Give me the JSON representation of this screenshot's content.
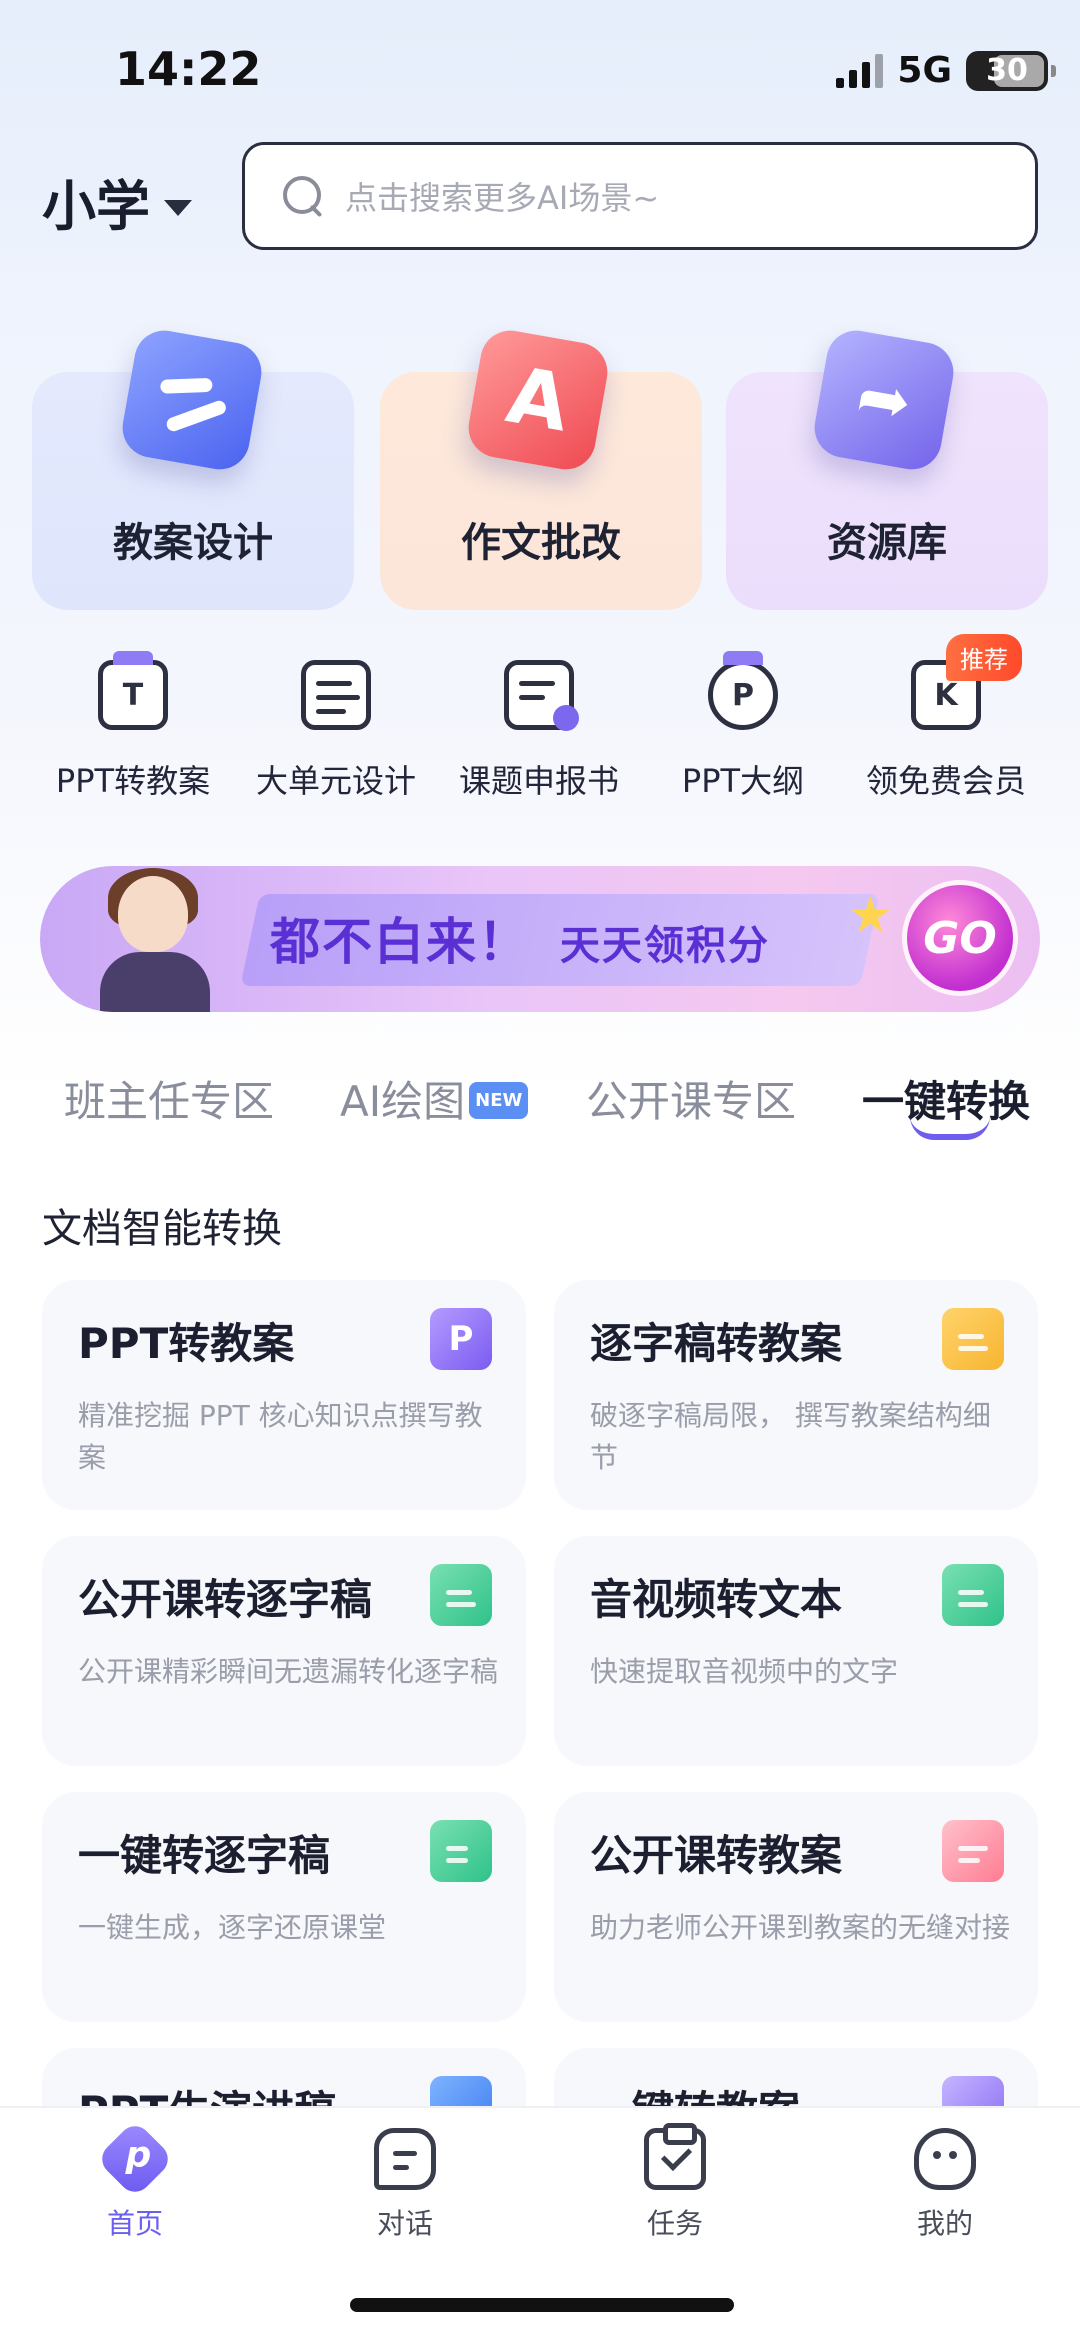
{
  "status": {
    "time": "14:22",
    "network": "5G",
    "battery": "30"
  },
  "header": {
    "grade": "小学",
    "search_placeholder": "点击搜索更多AI场景~"
  },
  "features": [
    {
      "label": "教案设计",
      "icon": "lesson-plan-icon"
    },
    {
      "label": "作文批改",
      "icon": "letter-a-icon"
    },
    {
      "label": "资源库",
      "icon": "folder-share-icon"
    }
  ],
  "tools": [
    {
      "label": "PPT转教案",
      "icon": "T"
    },
    {
      "label": "大单元设计",
      "icon": "unit-design-icon"
    },
    {
      "label": "课题申报书",
      "icon": "report-icon"
    },
    {
      "label": "PPT大纲",
      "icon": "P"
    },
    {
      "label": "领免费会员",
      "icon": "member-icon",
      "badge": "推荐"
    }
  ],
  "banner": {
    "main": "都不白来！",
    "sub": "天天领积分",
    "go": "GO"
  },
  "category_tabs": [
    {
      "label": "班主任专区"
    },
    {
      "label": "AI绘图",
      "badge": "NEW"
    },
    {
      "label": "公开课专区"
    },
    {
      "label": "一键转换",
      "active": true
    }
  ],
  "section_title": "文档智能转换",
  "convert_cards": [
    {
      "title": "PPT转教案",
      "desc": "精准挖掘 PPT 核心知识点撰写教案"
    },
    {
      "title": "逐字稿转教案",
      "desc": "破逐字稿局限， 撰写教案结构细节"
    },
    {
      "title": "公开课转逐字稿",
      "desc": "公开课精彩瞬间无遗漏转化逐字稿"
    },
    {
      "title": "音视频转文本",
      "desc": "快速提取音视频中的文字"
    },
    {
      "title": "一键转逐字稿",
      "desc": "一键生成，逐字还原课堂"
    },
    {
      "title": "公开课转教案",
      "desc": "助力老师公开课到教案的无缝对接"
    },
    {
      "title": "PPT生演讲稿",
      "desc": ""
    },
    {
      "title": "一键转教案",
      "desc": ""
    }
  ],
  "bottom_nav": [
    {
      "label": "首页",
      "active": true
    },
    {
      "label": "对话"
    },
    {
      "label": "任务"
    },
    {
      "label": "我的"
    }
  ]
}
